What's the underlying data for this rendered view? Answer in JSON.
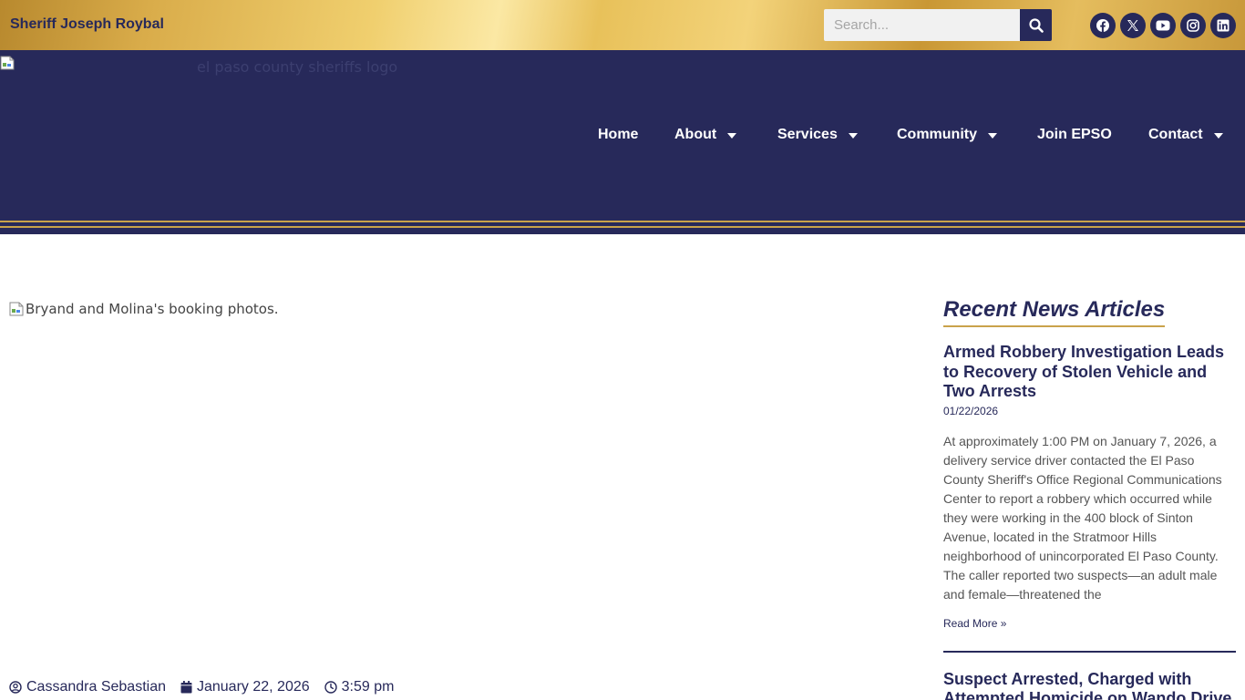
{
  "topbar": {
    "sheriff_name": "Sheriff Joseph Roybal",
    "search_placeholder": "Search...",
    "social_icons": [
      "facebook-icon",
      "x-twitter-icon",
      "youtube-icon",
      "instagram-icon",
      "linkedin-icon"
    ]
  },
  "header": {
    "logo_alt": "el paso county sheriffs logo",
    "nav": [
      {
        "label": "Home",
        "has_dropdown": false
      },
      {
        "label": "About",
        "has_dropdown": true
      },
      {
        "label": "Services",
        "has_dropdown": true
      },
      {
        "label": "Community",
        "has_dropdown": true
      },
      {
        "label": "Join EPSO",
        "has_dropdown": false
      },
      {
        "label": "Contact",
        "has_dropdown": true
      }
    ]
  },
  "article": {
    "image_alt": "Bryand and Molina's booking photos.",
    "author": "Cassandra Sebastian",
    "date": "January 22, 2026",
    "time": "3:59 pm"
  },
  "sidebar": {
    "title": "Recent News Articles",
    "articles": [
      {
        "title": "Armed Robbery Investigation Leads to Recovery of Stolen Vehicle and Two Arrests",
        "date": "01/22/2026",
        "excerpt": "At approximately 1:00 PM on January 7, 2026, a delivery service driver contacted the El Paso County Sheriff's Office Regional Communications Center to report a robbery which occurred while they were working in the 400 block of Sinton Avenue, located in the Stratmoor Hills neighborhood of unincorporated El Paso County. The caller reported two suspects—an adult male and female—threatened the",
        "read_more": "Read More »"
      },
      {
        "title": "Suspect Arrested, Charged with Attempted Homicide on Wando Drive"
      }
    ]
  },
  "colors": {
    "navy": "#27295a",
    "gold": "#c9a24a"
  }
}
